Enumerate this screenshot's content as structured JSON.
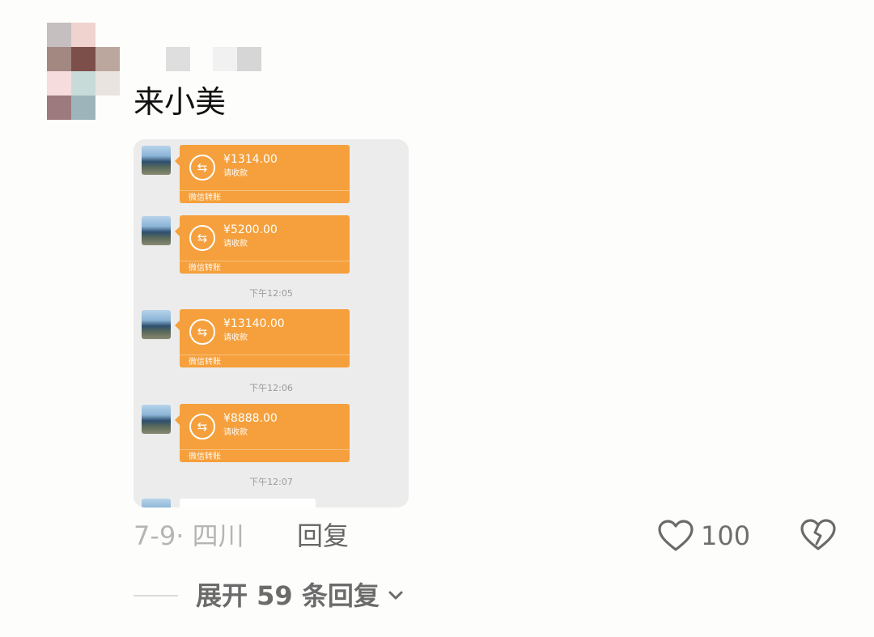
{
  "comment": {
    "text": "来小美",
    "location_date": "7-9· 四川",
    "reply_label": "回复",
    "like_count": "100",
    "expand_label": "展开 59 条回复"
  },
  "screenshot": {
    "messages": [
      {
        "amount": "¥1314.00",
        "status": "请收款",
        "footer": "微信转账"
      },
      {
        "amount": "¥5200.00",
        "status": "请收款",
        "footer": "微信转账"
      },
      {
        "amount": "¥13140.00",
        "status": "请收款",
        "footer": "微信转账"
      },
      {
        "amount": "¥8888.00",
        "status": "请收款",
        "footer": "微信转账"
      }
    ],
    "timestamps": [
      "下午12:05",
      "下午12:06",
      "下午12:07"
    ]
  },
  "icons": {
    "transfer": "transfer-icon",
    "like": "heart-outline-icon",
    "dislike": "broken-heart-icon",
    "expand": "chevron-down-icon"
  },
  "colors": {
    "transfer_bubble": "#f5a03c",
    "background": "#fdfdfb"
  }
}
